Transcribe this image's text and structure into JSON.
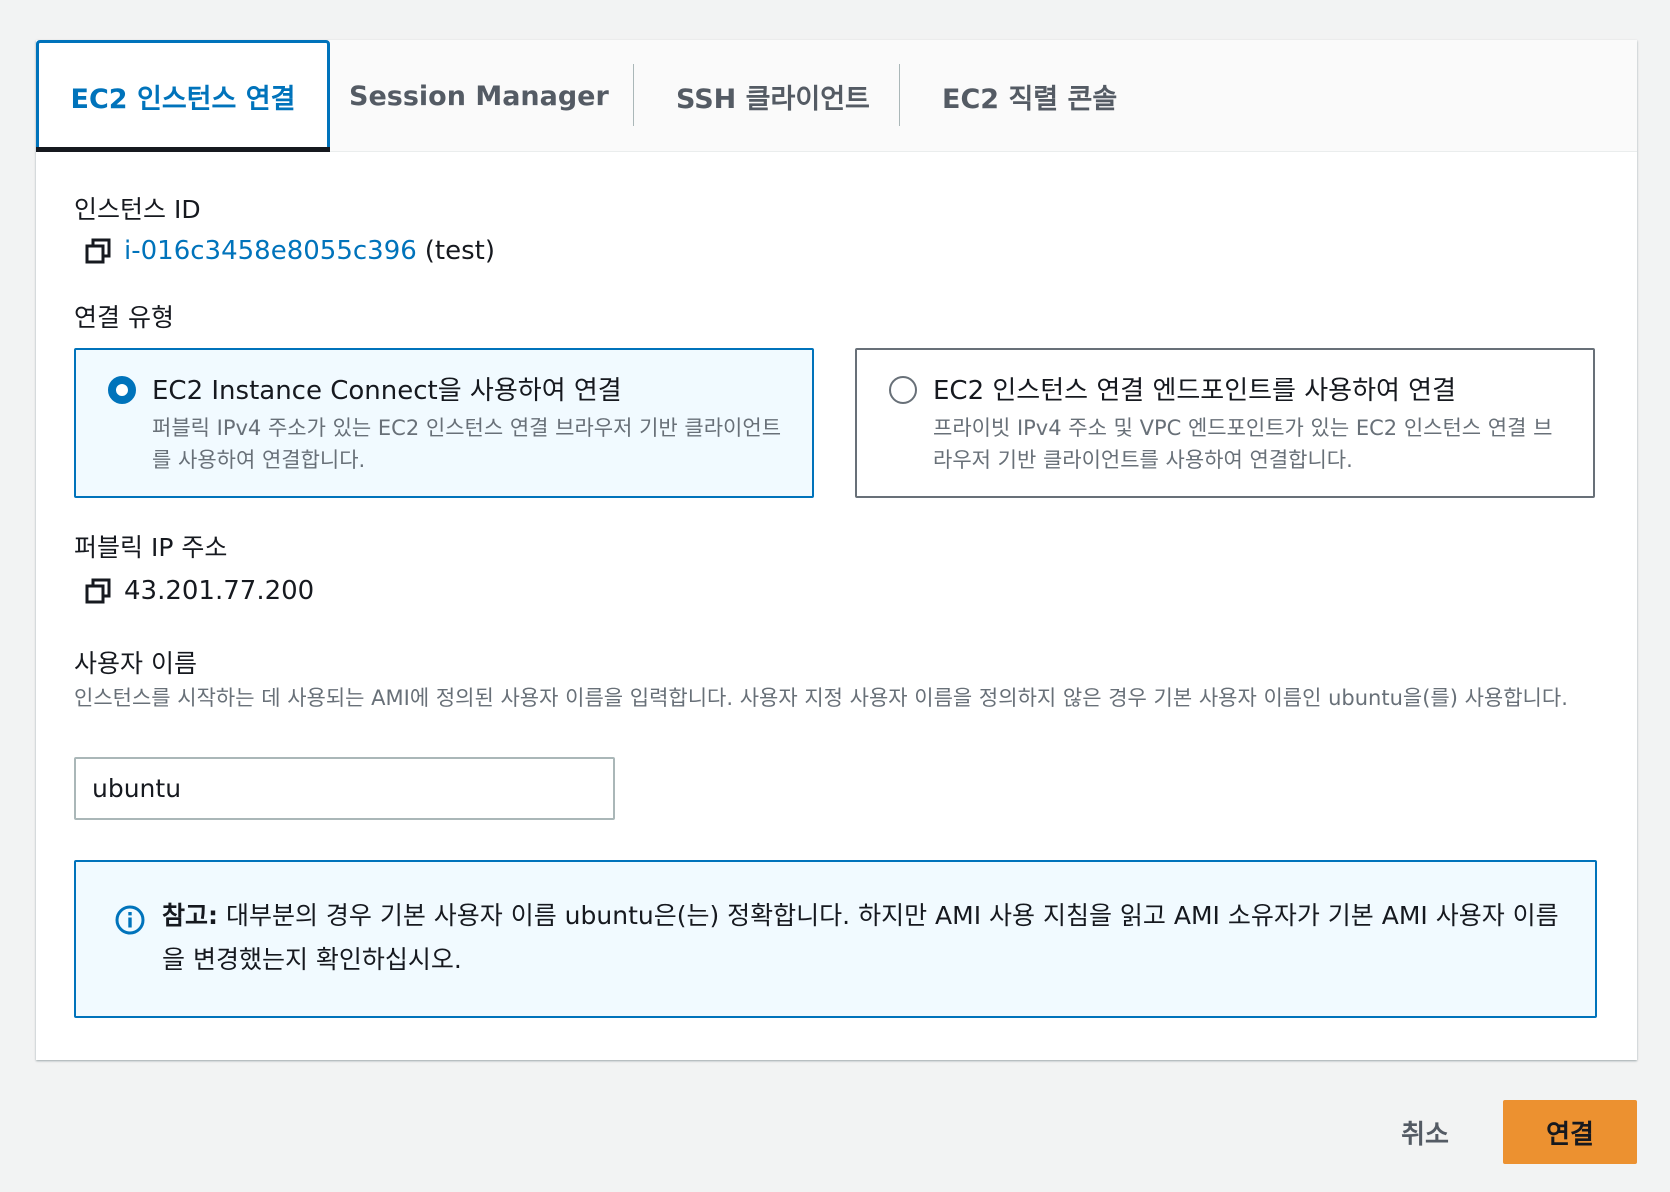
{
  "tabs": [
    {
      "label": "EC2 인스턴스 연결",
      "active": true
    },
    {
      "label": "Session Manager",
      "active": false
    },
    {
      "label": "SSH 클라이언트",
      "active": false
    },
    {
      "label": "EC2 직렬 콘솔",
      "active": false
    }
  ],
  "instance": {
    "label": "인스턴스 ID",
    "id": "i-016c3458e8055c396",
    "name": "(test)"
  },
  "connection_type": {
    "label": "연결 유형",
    "options": [
      {
        "title": "EC2 Instance Connect을 사용하여 연결",
        "description": "퍼블릭 IPv4 주소가 있는 EC2 인스턴스 연결 브라우저 기반 클라이언트를 사용하여 연결합니다.",
        "selected": true
      },
      {
        "title": "EC2 인스턴스 연결 엔드포인트를 사용하여 연결",
        "description": "프라이빗 IPv4 주소 및 VPC 엔드포인트가 있는 EC2 인스턴스 연결 브라우저 기반 클라이언트를 사용하여 연결합니다.",
        "selected": false
      }
    ]
  },
  "public_ip": {
    "label": "퍼블릭 IP 주소",
    "value": "43.201.77.200"
  },
  "username": {
    "label": "사용자 이름",
    "description": "인스턴스를 시작하는 데 사용되는 AMI에 정의된 사용자 이름을 입력합니다. 사용자 지정 사용자 이름을 정의하지 않은 경우 기본 사용자 이름인 ubuntu을(를) 사용합니다.",
    "value": "ubuntu"
  },
  "note": {
    "prefix": "참고:",
    "text": " 대부분의 경우 기본 사용자 이름 ubuntu은(는) 정확합니다. 하지만 AMI 사용 지침을 읽고 AMI 소유자가 기본 AMI 사용자 이름을 변경했는지 확인하십시오."
  },
  "actions": {
    "cancel": "취소",
    "connect": "연결"
  },
  "colors": {
    "accent": "#0073bb",
    "primary_button": "#ec9130",
    "tile_selected_bg": "#f1faff"
  },
  "icons": {
    "copy": "copy-icon",
    "info": "info-icon"
  }
}
